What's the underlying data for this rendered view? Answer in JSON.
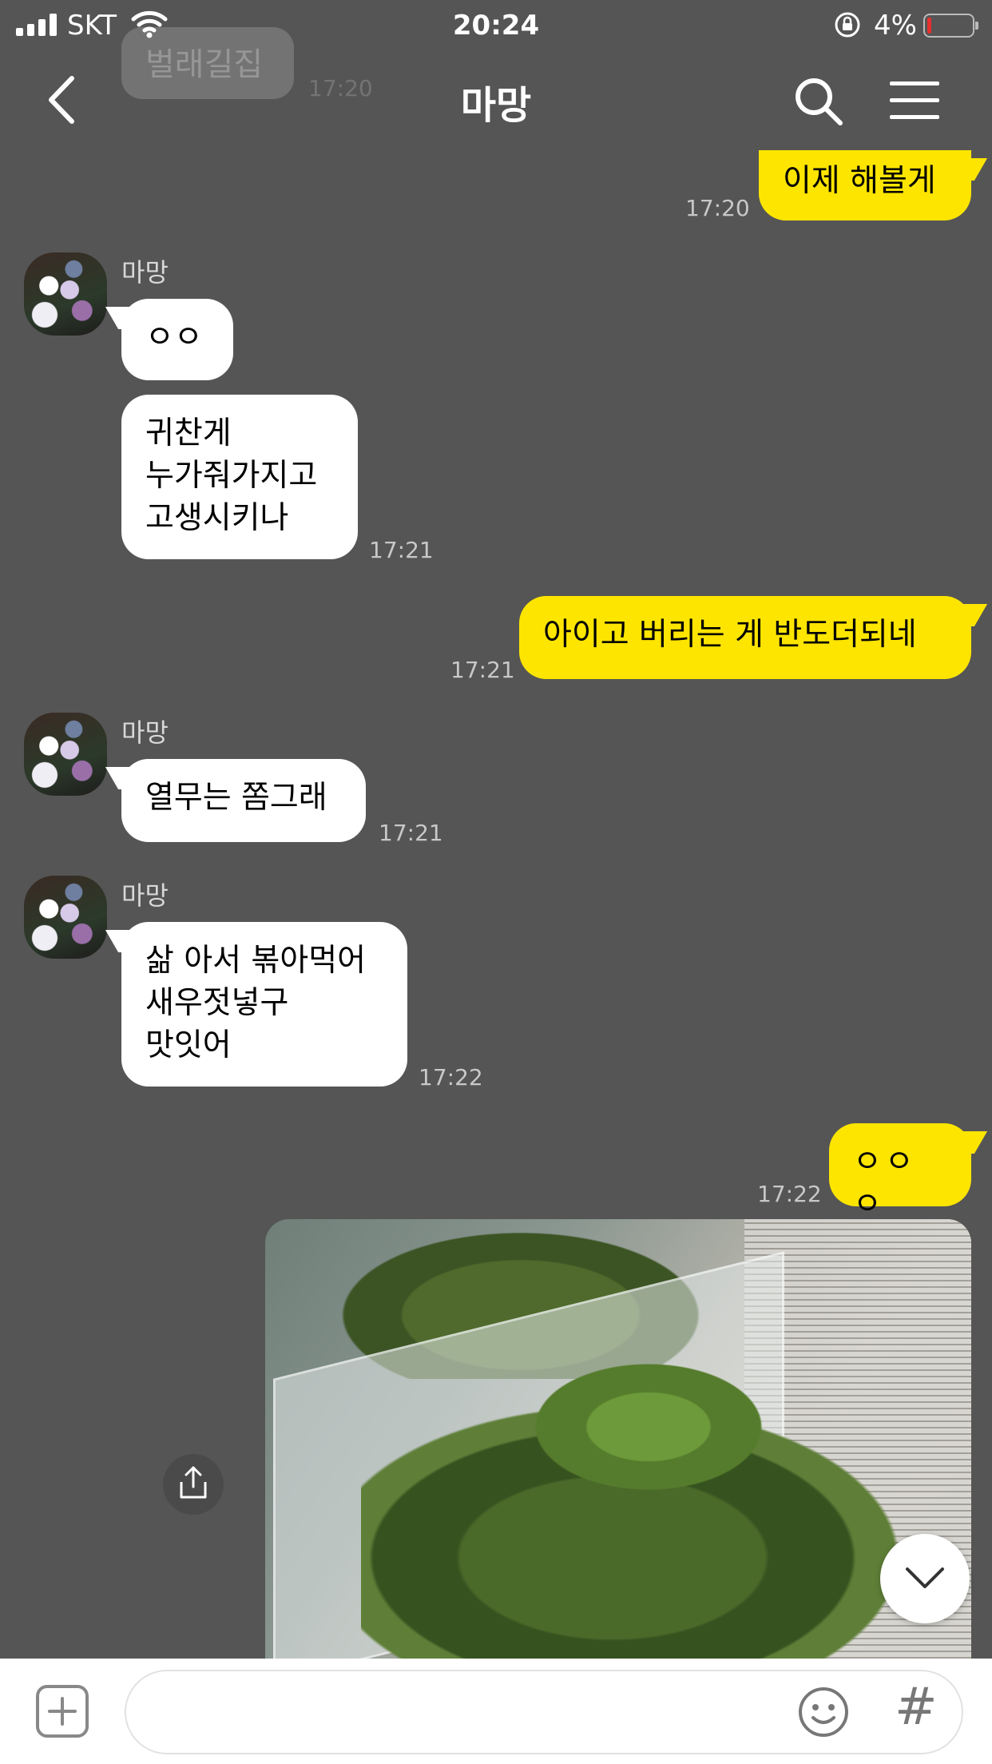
{
  "status_bar": {
    "carrier": "SKT",
    "clock": "20:24",
    "battery_percent": "4%",
    "battery_level": 0.04
  },
  "background_ghost": {
    "bubble_text": "벌래길집",
    "time": "17:20"
  },
  "header": {
    "title": "마망"
  },
  "messages": [
    {
      "side": "out",
      "text": "이제 해볼게",
      "time": "17:20"
    },
    {
      "side": "in",
      "sender": "마망",
      "text": "ㅇㅇ"
    },
    {
      "side": "in",
      "text": "귀찬게\n누가줘가지고\n고생시키나",
      "time": "17:21"
    },
    {
      "side": "out",
      "text": "아이고 버리는 게 반도더되네",
      "time": "17:21"
    },
    {
      "side": "in",
      "sender": "마망",
      "text": "열무는 쫌그래",
      "time": "17:21"
    },
    {
      "side": "in",
      "sender": "마망",
      "text": "삶 아서 볶아먹어\n새우젓넣구\n맛잇어",
      "time": "17:22"
    },
    {
      "side": "out",
      "text": "ㅇㅇㅇ",
      "time": "17:22"
    }
  ],
  "icons": {
    "back": "chevron-left-icon",
    "search": "search-icon",
    "menu": "hamburger-menu-icon",
    "share": "share-icon",
    "scroll_down": "chevron-down-icon",
    "attach": "plus-square-icon",
    "emoji": "emoji-icon"
  },
  "input": {
    "value": "",
    "hash_label": "#"
  },
  "colors": {
    "background": "#555555",
    "outgoing_bubble": "#fee500",
    "incoming_bubble": "#ffffff",
    "battery_low": "#e63030"
  }
}
